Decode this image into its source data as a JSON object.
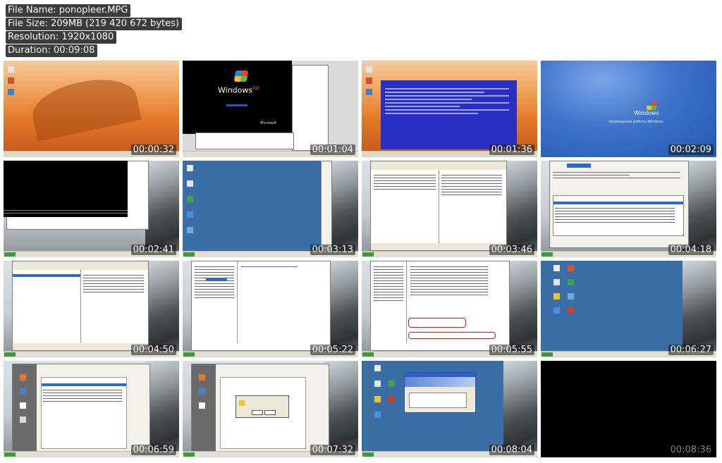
{
  "info": {
    "file_name": "File Name: ponopleer.MPG",
    "file_size": "File Size: 209MB (219 420 672 bytes)",
    "resolution": "Resolution: 1920x1080",
    "duration": "Duration: 00:09:08"
  },
  "thumbnails": [
    {
      "time": "00:00:32"
    },
    {
      "time": "00:01:04"
    },
    {
      "time": "00:01:36"
    },
    {
      "time": "00:02:09"
    },
    {
      "time": "00:02:41"
    },
    {
      "time": "00:03:13"
    },
    {
      "time": "00:03:46"
    },
    {
      "time": "00:04:18"
    },
    {
      "time": "00:04:50"
    },
    {
      "time": "00:05:22"
    },
    {
      "time": "00:05:55"
    },
    {
      "time": "00:06:27"
    },
    {
      "time": "00:06:59"
    },
    {
      "time": "00:07:32"
    },
    {
      "time": "00:08:04"
    },
    {
      "time": "00:08:36"
    }
  ],
  "embedded_text": {
    "winxp_brand": "Windows",
    "winxp_xp": "xp",
    "microsoft": "Microsoft",
    "boot_caption": "Запрещение работы Windows"
  },
  "colors": {
    "xp_blue": "#3a6ea5",
    "bsod_blue": "#2a2fc4",
    "desert": "#e98a34"
  }
}
